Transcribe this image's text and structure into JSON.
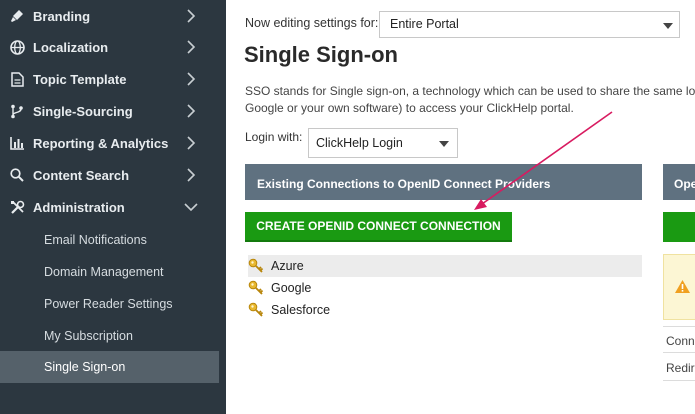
{
  "sidebar": {
    "items": [
      {
        "label": "Branding",
        "icon": "brush-icon"
      },
      {
        "label": "Localization",
        "icon": "globe-icon"
      },
      {
        "label": "Topic Template",
        "icon": "document-icon"
      },
      {
        "label": "Single-Sourcing",
        "icon": "branch-icon"
      },
      {
        "label": "Reporting & Analytics",
        "icon": "bar-chart-icon"
      },
      {
        "label": "Content Search",
        "icon": "search-icon"
      },
      {
        "label": "Administration",
        "icon": "tools-icon"
      }
    ],
    "subitems": [
      {
        "label": "Email Notifications"
      },
      {
        "label": "Domain Management"
      },
      {
        "label": "Power Reader Settings"
      },
      {
        "label": "My Subscription"
      },
      {
        "label": "Single Sign-on",
        "active": true
      }
    ]
  },
  "main": {
    "editing_label": "Now editing settings for:",
    "portal_select": "Entire Portal",
    "title": "Single Sign-on",
    "description_line1": "SSO stands for Single sign-on, a technology which can be used to share the same log",
    "description_line2": "Google or your own software) to access your ClickHelp portal.",
    "login_label": "Login with:",
    "login_select": "ClickHelp Login",
    "panel_header": "Existing Connections to OpenID Connect Providers",
    "panel2_header": "Ope",
    "create_button": "CREATE OPENID CONNECT CONNECTION",
    "providers": [
      "Azure",
      "Google",
      "Salesforce"
    ],
    "right_text_1": "Conne",
    "right_text_2": "Redire"
  },
  "colors": {
    "sidebar_bg": "#2c3740",
    "sidebar_active": "#55616a",
    "panel_header": "#5f7180",
    "create_button": "#1a9a12",
    "annotation_arrow": "#d81b60"
  }
}
